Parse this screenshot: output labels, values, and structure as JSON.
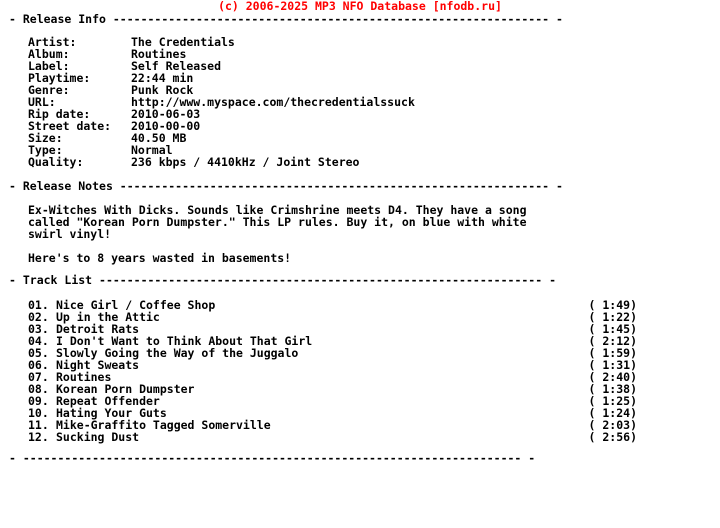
{
  "banner": {
    "text": "(c) 2006-2025 MP3 NFO Database [nfodb.ru]",
    "color": "#ff0000"
  },
  "sections": {
    "release_info": {
      "marker": "- ",
      "title": "Release Info ",
      "dashes": "---------------------------------------------------------------",
      "tail": " -"
    },
    "release_notes": {
      "marker": "- ",
      "title": "Release Notes ",
      "dashes": "--------------------------------------------------------------",
      "tail": " -"
    },
    "track_list": {
      "marker": "- ",
      "title": "Track List ",
      "dashes": "----------------------------------------------------------------",
      "tail": " -"
    },
    "footer": {
      "marker": "- ",
      "dashes": "------------------------------------------------------------------------",
      "tail": " -"
    }
  },
  "release_info": {
    "fields": [
      {
        "label": "Artist:",
        "value": "The Credentials"
      },
      {
        "label": "Album:",
        "value": "Routines"
      },
      {
        "label": "Label:",
        "value": "Self Released"
      },
      {
        "label": "Playtime:",
        "value": "22:44 min"
      },
      {
        "label": "Genre:",
        "value": "Punk Rock"
      },
      {
        "label": "URL:",
        "value": "http://www.myspace.com/thecredentialssuck"
      },
      {
        "label": "Rip date:",
        "value": "2010-06-03"
      },
      {
        "label": "Street date:",
        "value": "2010-00-00"
      },
      {
        "label": "Size:",
        "value": "40.50 MB"
      },
      {
        "label": "Type:",
        "value": "Normal"
      },
      {
        "label": "Quality:",
        "value": "236 kbps / 4410kHz / Joint Stereo"
      }
    ]
  },
  "release_notes": {
    "lines": [
      "Ex-Witches With Dicks. Sounds like Crimshrine meets D4. They have a song",
      "called \"Korean Porn Dumpster.\" This LP rules. Buy it, on blue with white",
      "swirl vinyl!",
      "",
      "Here's to 8 years wasted in basements!"
    ]
  },
  "track_list": {
    "tracks": [
      {
        "num": "01.",
        "title": "Nice Girl / Coffee Shop",
        "time": "( 1:49)"
      },
      {
        "num": "02.",
        "title": "Up in the Attic",
        "time": "( 1:22)"
      },
      {
        "num": "03.",
        "title": "Detroit Rats",
        "time": "( 1:45)"
      },
      {
        "num": "04.",
        "title": "I Don't Want to Think About That Girl",
        "time": "( 2:12)"
      },
      {
        "num": "05.",
        "title": "Slowly Going the Way of the Juggalo",
        "time": "( 1:59)"
      },
      {
        "num": "06.",
        "title": "Night Sweats",
        "time": "( 1:31)"
      },
      {
        "num": "07.",
        "title": "Routines",
        "time": "( 2:40)"
      },
      {
        "num": "08.",
        "title": "Korean Porn Dumpster",
        "time": "( 1:38)"
      },
      {
        "num": "09.",
        "title": "Repeat Offender",
        "time": "( 1:25)"
      },
      {
        "num": "10.",
        "title": "Hating Your Guts",
        "time": "( 1:24)"
      },
      {
        "num": "11.",
        "title": "Mike-Graffito Tagged Somerville",
        "time": "( 2:03)"
      },
      {
        "num": "12.",
        "title": "Sucking Dust",
        "time": "( 2:56)"
      }
    ]
  }
}
